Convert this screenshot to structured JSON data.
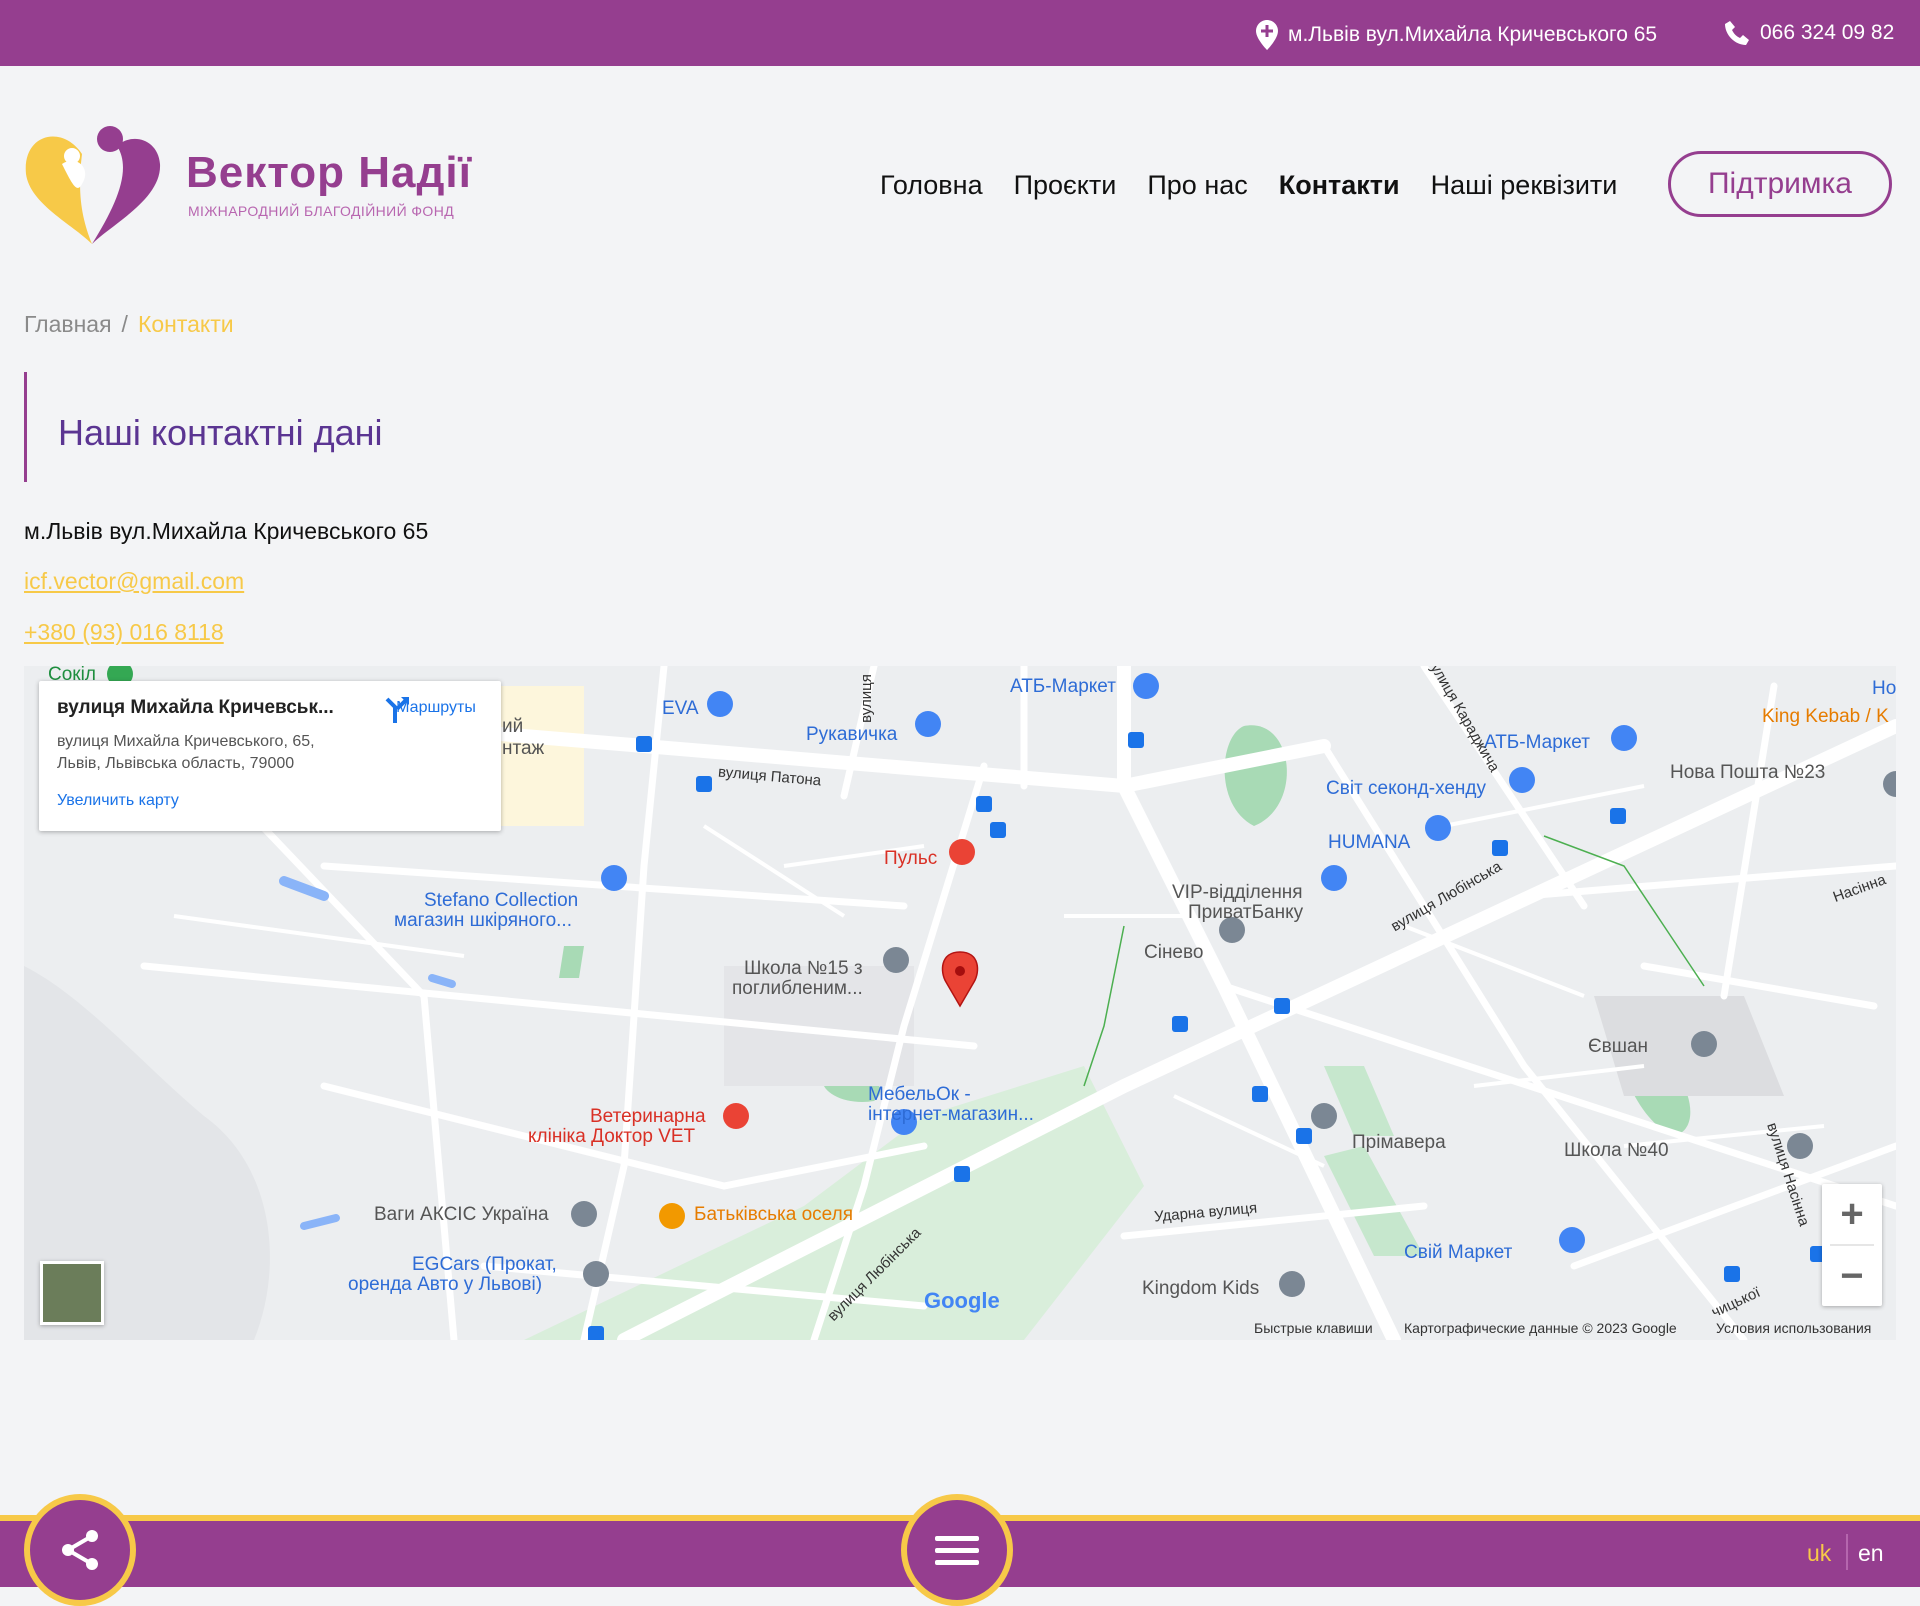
{
  "topbar": {
    "address": "м.Львів вул.Михайла Кричевського 65",
    "phone": "066 324 09 82"
  },
  "brand": {
    "name": "Вектор Надії",
    "subtitle": "Міжнародний благодійний фонд"
  },
  "nav": {
    "items": [
      {
        "label": "Головна"
      },
      {
        "label": "Проєкти"
      },
      {
        "label": "Про нас"
      },
      {
        "label": "Контакти",
        "active": true
      },
      {
        "label": "Наші реквізити"
      }
    ],
    "support_label": "Підтримка"
  },
  "breadcrumb": {
    "home": "Главная",
    "separator": "/",
    "current": "Контакти"
  },
  "contacts": {
    "heading": "Наші контактні дані",
    "address": "м.Львів вул.Михайла Кричевського 65",
    "email": "icf.vector@gmail.com",
    "phone": "+380 (93) 016 8118"
  },
  "map": {
    "card": {
      "title": "вулиця Михайла Кричевськ...",
      "address_line1": "вулиця Михайла Кричевського, 65,",
      "address_line2": "Львів, Львівська область, 79000",
      "directions": "Маршруты",
      "enlarge": "Увеличить карту"
    },
    "places": {
      "sokil": "Сокіл",
      "montazh1": "ий",
      "montazh2": "нтаж",
      "eva": "EVA",
      "rukavychka": "Рукавичка",
      "atb1": "АТБ-Маркет",
      "atb2": "АТБ-Маркет",
      "king_kebab": "King Kebab / K",
      "ho": "Но",
      "nova_poshta": "Нова Пошта №23",
      "svit_second": "Світ секонд-хенду",
      "humana": "HUMANA",
      "puls": "Пульс",
      "vip1": "VIP-відділення",
      "vip2": "ПриватБанку",
      "sinevo": "Сінево",
      "stefano1": "Stefano Collection",
      "stefano2": "магазин шкіряного...",
      "school15_1": "Школа №15 з",
      "school15_2": "поглибленим...",
      "yevshan": "Євшан",
      "mebel1": "МебельОк -",
      "mebel2": "інтернет-магазин...",
      "vet1": "Ветеринарна",
      "vet2": "клініка Доктор VET",
      "primavera": "Прімавера",
      "school40": "Школа №40",
      "vagy": "Ваги АКСІС Україна",
      "batkivska": "Батьківська оселя",
      "svii_market": "Свій Маркет",
      "egcars1": "EGCars (Прокат,",
      "egcars2": "оренда Авто у Львові)",
      "kingdom_kids": "Kingdom Kids"
    },
    "streets": {
      "patona": "вулиця Патона",
      "vulytsia_top": "вулиця",
      "karadzhycha": "вулиця Караджича",
      "liubinska_ne": "вулиця Любінська",
      "liubinska_sw": "вулиця Любінська",
      "nasinna_right": "Насінна",
      "nasinna_vert": "вулиця Насінна",
      "udarna": "Ударна вулиця",
      "chytskoi": "чицької"
    },
    "zoom_in": "+",
    "zoom_out": "−",
    "google": "Google",
    "footer": {
      "shortcuts": "Быстрые клавиши",
      "map_data": "Картографические данные © 2023 Google",
      "terms": "Условия использования"
    }
  },
  "language": {
    "uk": "uk",
    "en": "en"
  },
  "colors": {
    "brand_purple": "#953e8f",
    "accent_yellow": "#f7c948",
    "heading_purple": "#5b3592"
  }
}
